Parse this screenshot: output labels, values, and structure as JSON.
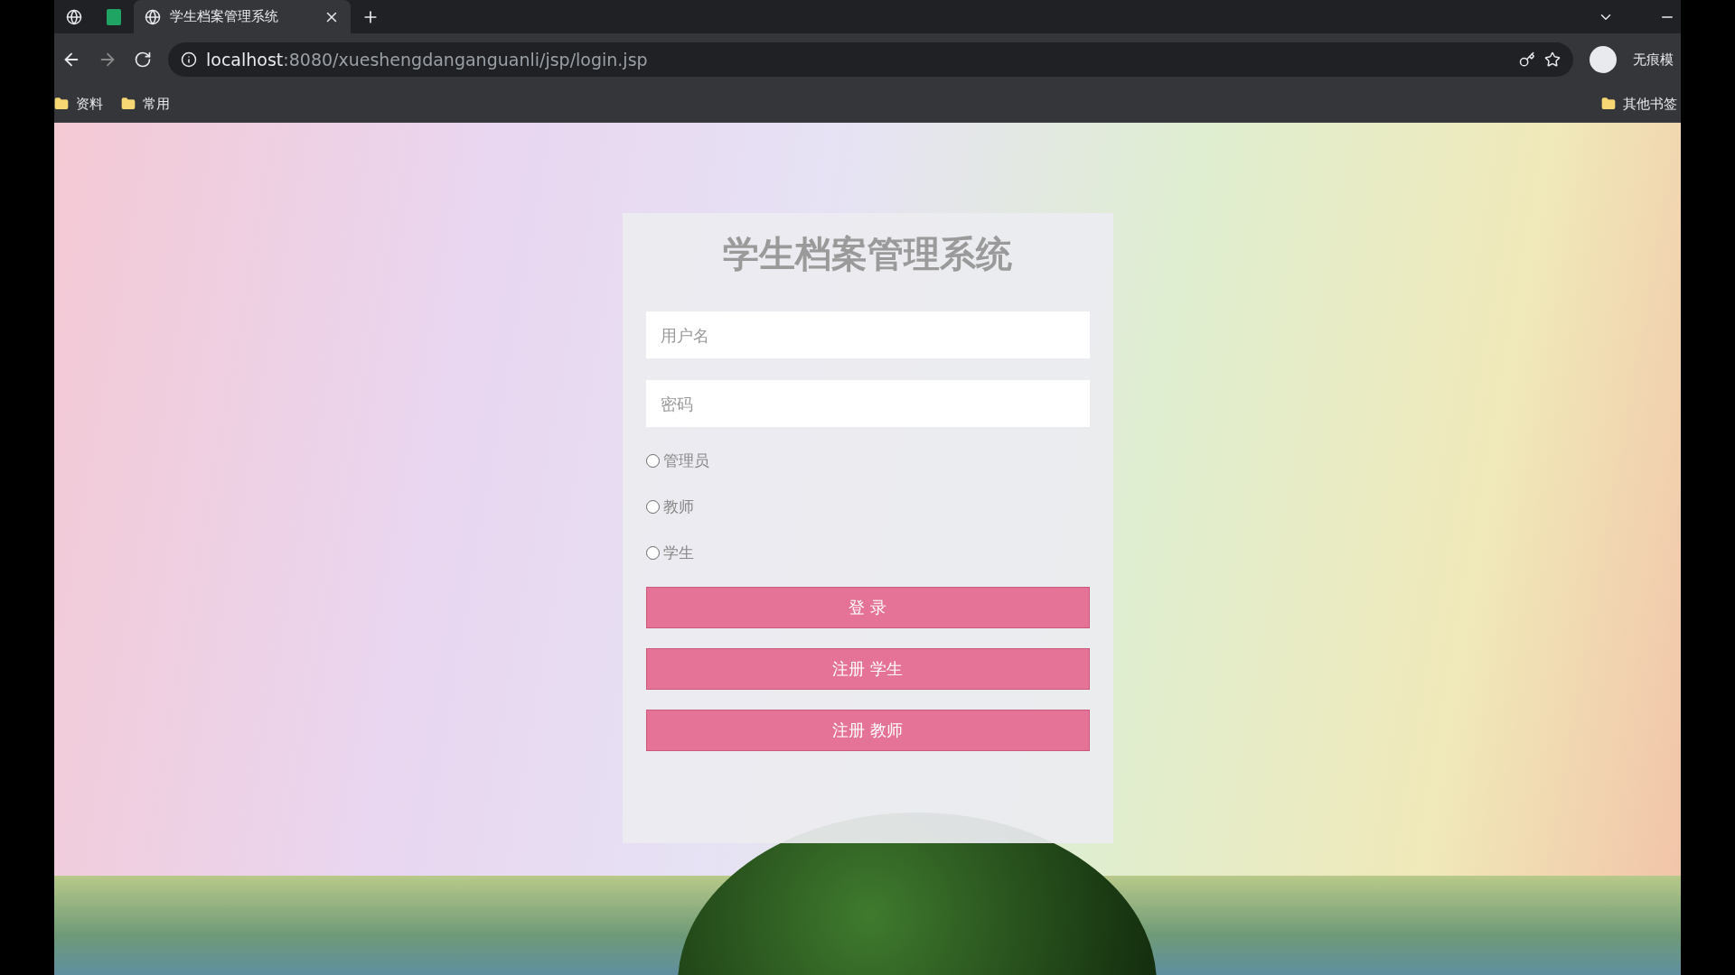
{
  "browser": {
    "tabs": [
      {
        "kind": "pinned-globe",
        "selected": false
      },
      {
        "kind": "pinned-sheet",
        "selected": false
      },
      {
        "kind": "page",
        "title": "学生档案管理系统",
        "selected": true
      }
    ],
    "address": {
      "host": "localhost",
      "path": ":8080/xueshengdanganguanli/jsp/login.jsp"
    },
    "profile_label": "无痕模",
    "bookmarks": [
      "资料",
      "常用"
    ],
    "other_bookmarks": "其他书签"
  },
  "login": {
    "title": "学生档案管理系统",
    "fields": [
      {
        "placeholder": "用户名"
      },
      {
        "placeholder": "密码"
      }
    ],
    "roles": [
      {
        "label": "管理员",
        "selected": false
      },
      {
        "label": "教师",
        "selected": false
      },
      {
        "label": "学生",
        "selected": false
      }
    ],
    "buttons": [
      "登 录",
      "注册 学生",
      "注册 教师"
    ]
  }
}
